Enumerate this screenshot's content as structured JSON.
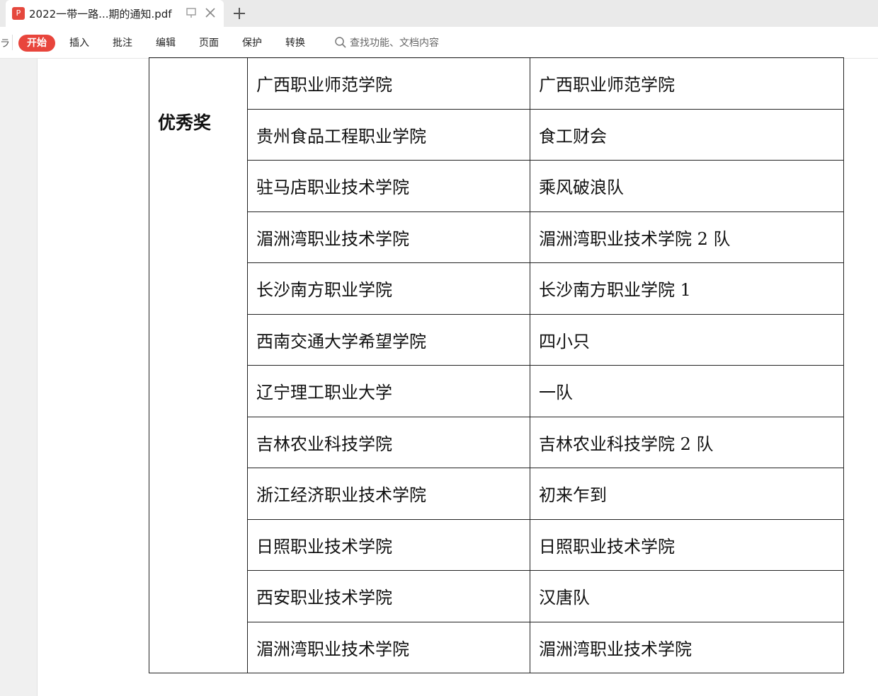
{
  "tabbar": {
    "active_tab": {
      "icon": "pdf-file-icon",
      "title": "2022一带一路...期的通知.pdf",
      "pdf_glyph": "P"
    },
    "new_tab_icon": "plus-icon"
  },
  "toolbar": {
    "cut_label": "ラ",
    "items": [
      "开始",
      "插入",
      "批注",
      "编辑",
      "页面",
      "保护",
      "转换"
    ],
    "active_index": 0,
    "search_placeholder": "查找功能、文档内容"
  },
  "document": {
    "award_category": "优秀奖",
    "rows": [
      {
        "school": "广西职业师范学院",
        "team": "广西职业师范学院"
      },
      {
        "school": "贵州食品工程职业学院",
        "team": "食工财会"
      },
      {
        "school": "驻马店职业技术学院",
        "team": "乘风破浪队"
      },
      {
        "school": "湄洲湾职业技术学院",
        "team": "湄洲湾职业技术学院 2 队"
      },
      {
        "school": "长沙南方职业学院",
        "team": "长沙南方职业学院 1"
      },
      {
        "school": "西南交通大学希望学院",
        "team": "四小只"
      },
      {
        "school": "辽宁理工职业大学",
        "team": "一队"
      },
      {
        "school": "吉林农业科技学院",
        "team": "吉林农业科技学院 2 队"
      },
      {
        "school": "浙江经济职业技术学院",
        "team": "初来乍到"
      },
      {
        "school": "日照职业技术学院",
        "team": "日照职业技术学院"
      },
      {
        "school": "西安职业技术学院",
        "team": "汉唐队"
      },
      {
        "school": "湄洲湾职业技术学院",
        "team": "湄洲湾职业技术学院"
      }
    ]
  },
  "colors": {
    "accent": "#e8453c",
    "tabbar_bg": "#eaeaea",
    "side_panel": "#f0f0f0"
  }
}
